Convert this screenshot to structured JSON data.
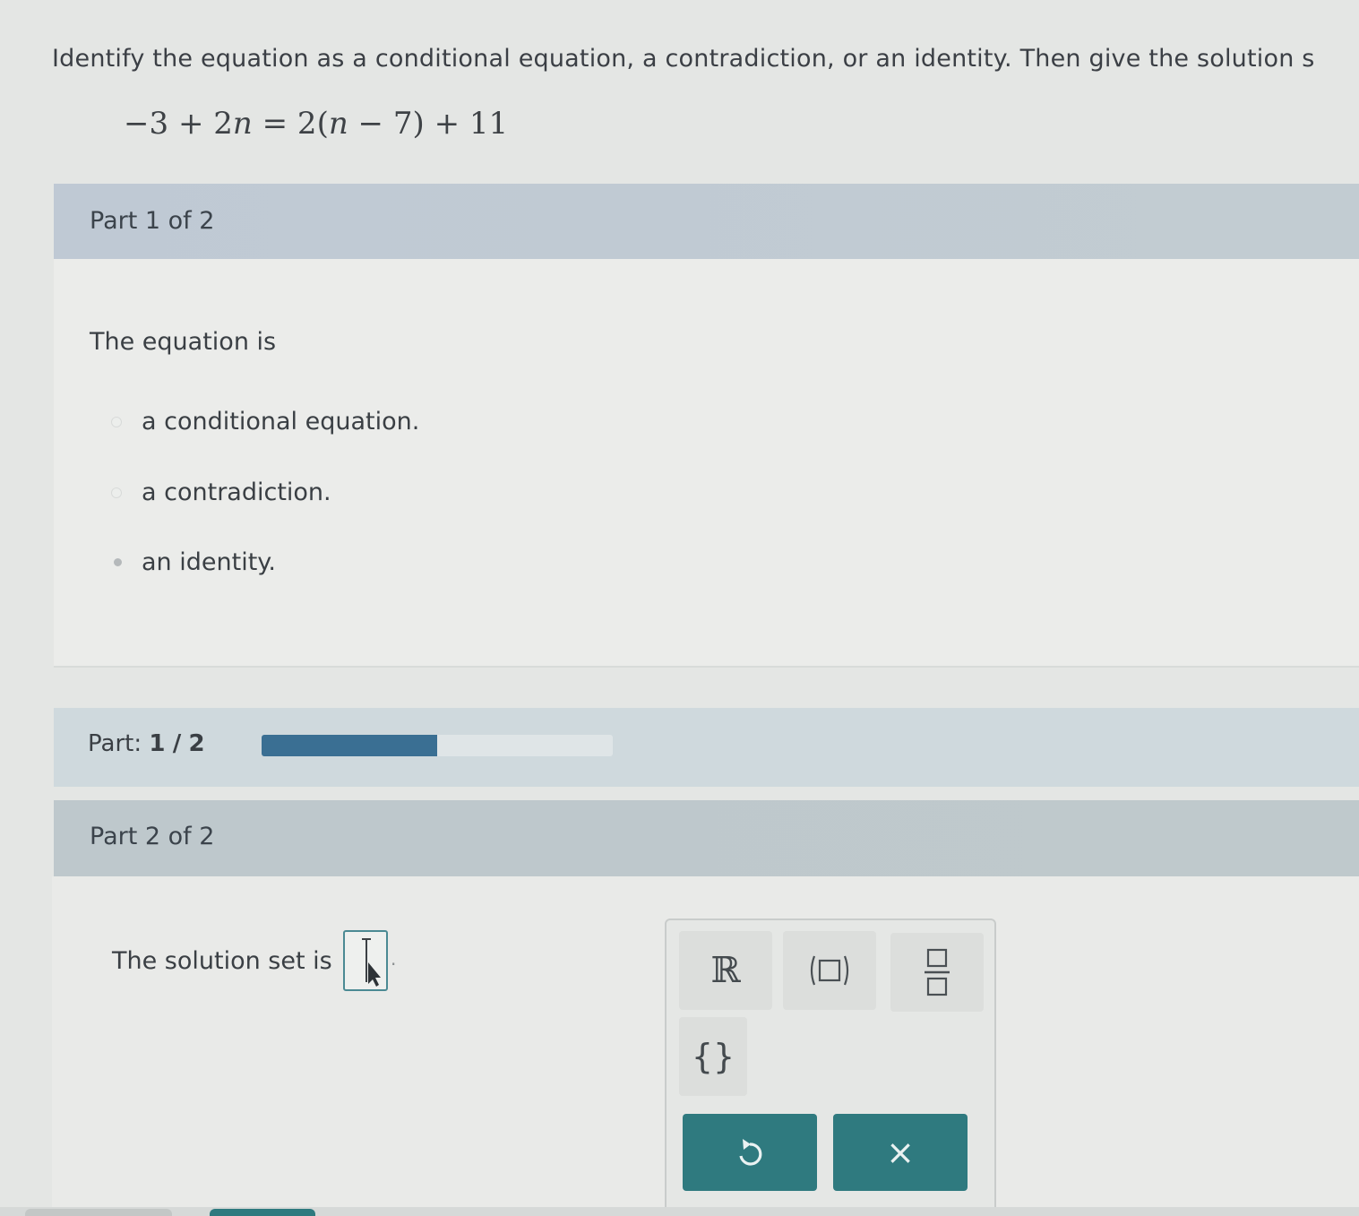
{
  "question": {
    "text": "Identify the equation as a conditional equation, a contradiction, or an identity. Then give the solution s",
    "equation": {
      "lhs_const": "−3",
      "plus1": "+",
      "lhs_coef": "2",
      "var1": "n",
      "equals": "=",
      "rhs_coef": "2",
      "open_paren": "(",
      "var2": "n",
      "minus": "−",
      "rhs_inner": "7",
      "close_paren": ")",
      "plus2": "+",
      "rhs_const": "11"
    }
  },
  "part1": {
    "header": "Part 1 of 2",
    "prompt": "The equation is",
    "options": [
      {
        "label": "a conditional equation.",
        "selected": false
      },
      {
        "label": "a contradiction.",
        "selected": false
      },
      {
        "label": "an identity.",
        "selected": true
      }
    ]
  },
  "progress": {
    "label": "Part:",
    "current": "1",
    "separator": "/",
    "total": "2",
    "fraction": 0.5
  },
  "part2": {
    "header": "Part 2 of 2",
    "solution_label": "The solution set is",
    "answer_value": "",
    "period": "."
  },
  "keypad": {
    "real_numbers": "ℝ",
    "set_braces": "{}",
    "keys": [
      "real-numbers",
      "interval",
      "fraction",
      "set-braces"
    ],
    "undo_icon": "undo-icon",
    "clear_icon": "close-icon",
    "clear_symbol": "×"
  },
  "colors": {
    "accent": "#2f7a7f",
    "progress_fill": "#3a6f93",
    "header_bg": "#bcc6cf"
  }
}
